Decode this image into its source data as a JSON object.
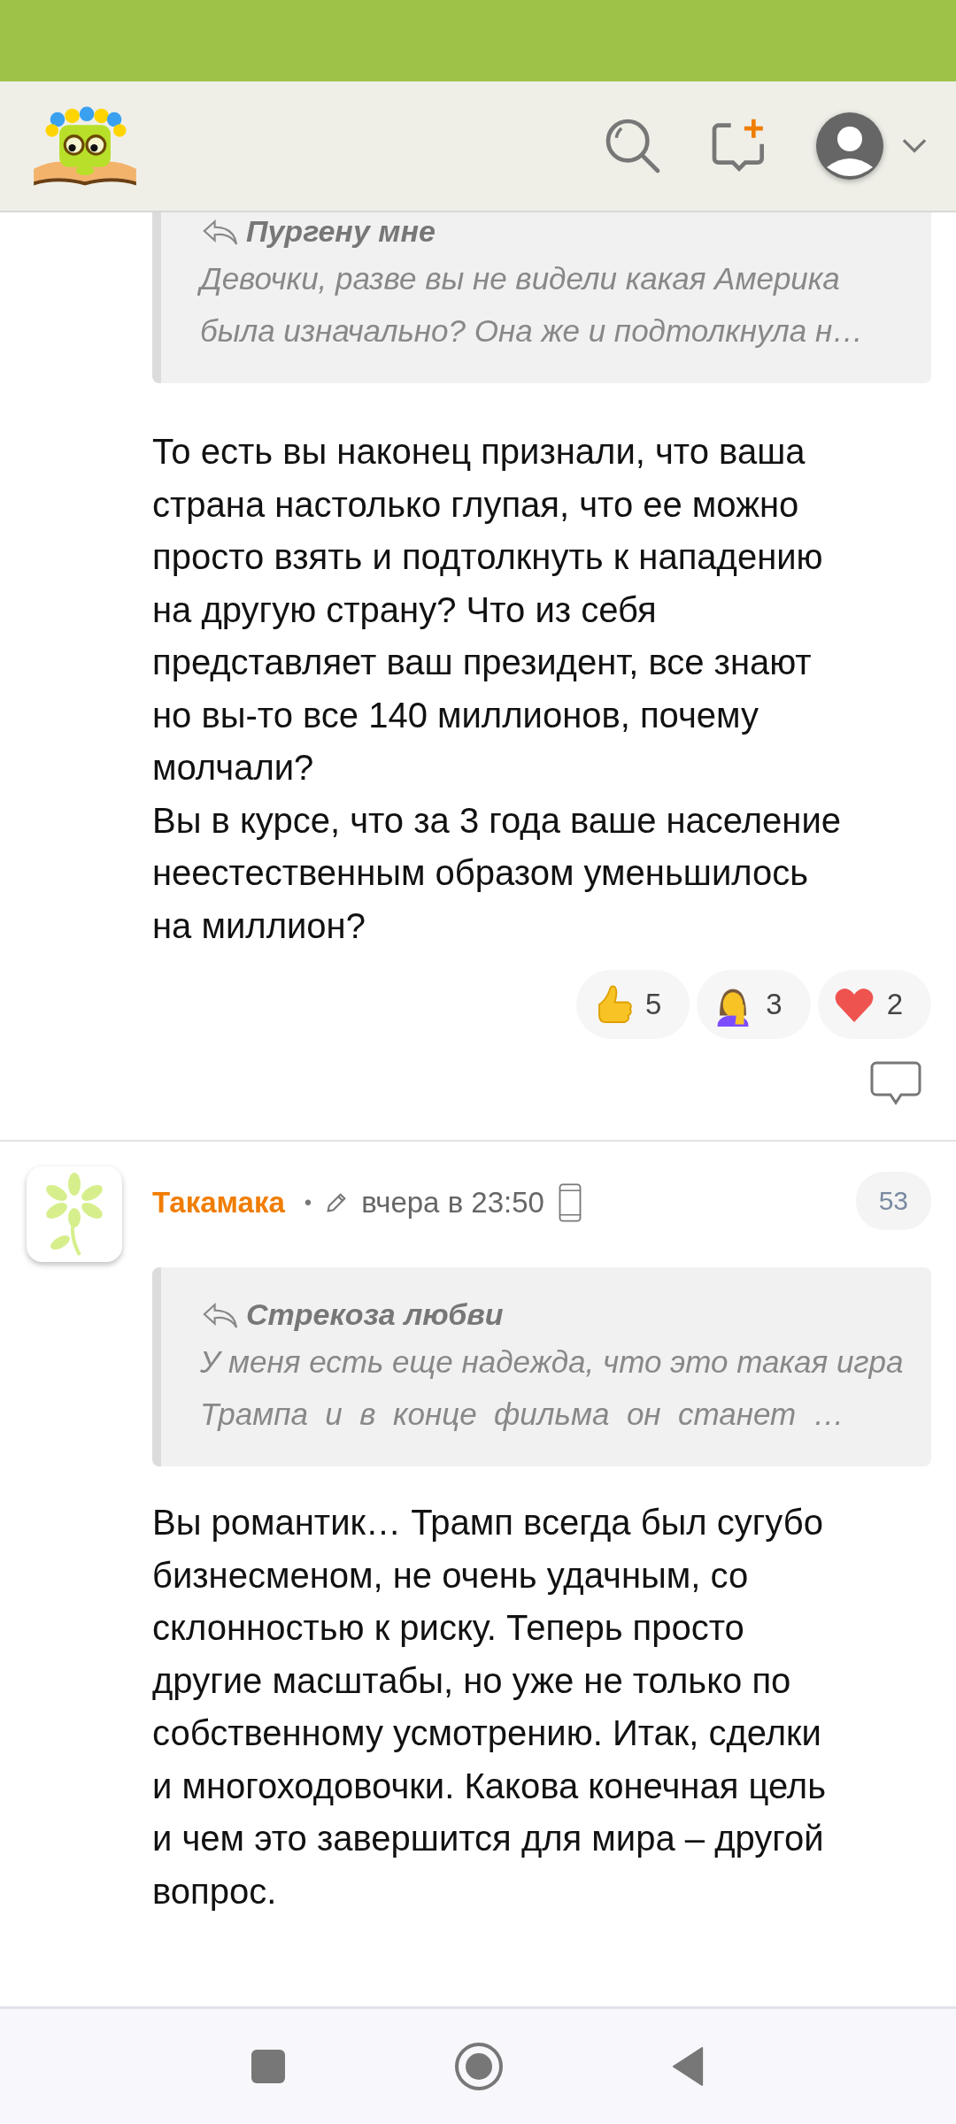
{
  "comments": [
    {
      "quote": {
        "author": "Пургену мне",
        "text": "Девочки, разве вы не видели какая Америка\nбыла изначально? Она же и подтолкнула н…"
      },
      "body": "То есть вы наконец признали, что ваша\nстрана настолько глупая, что ее можно\nпросто взять и подтолкнуть к нападению\nна другую страну? Что из себя\nпредставляет ваш президент, все знают\nно вы-то все 140 миллионов, почему\nмолчали?\nВы в курсе, что за 3 года ваше население\nнеестественным образом уменьшилось\nна миллион?",
      "reactions": [
        {
          "kind": "like",
          "count": "5"
        },
        {
          "kind": "facepalm",
          "count": "3"
        },
        {
          "kind": "heart",
          "count": "2"
        }
      ]
    },
    {
      "author": "Такамака",
      "separator": "•",
      "time": "вчера в 23:50",
      "number": "53",
      "quote": {
        "author": "Стрекоза любви",
        "text": "У меня есть еще надежда, что это такая игра\nТрампа  и  в  конце  фильма  он  станет  …"
      },
      "body": "Вы романтик… Трамп всегда был сугубо\nбизнесменом, не очень удачным, со\nсклонностью к риску. Теперь просто\nдругие масштабы, но уже не только по\nсобственному усмотрению. Итак, сделки\nи многоходовочки. Какова конечная цель\nи чем это завершится для мира – другой\nвопрос."
    }
  ]
}
